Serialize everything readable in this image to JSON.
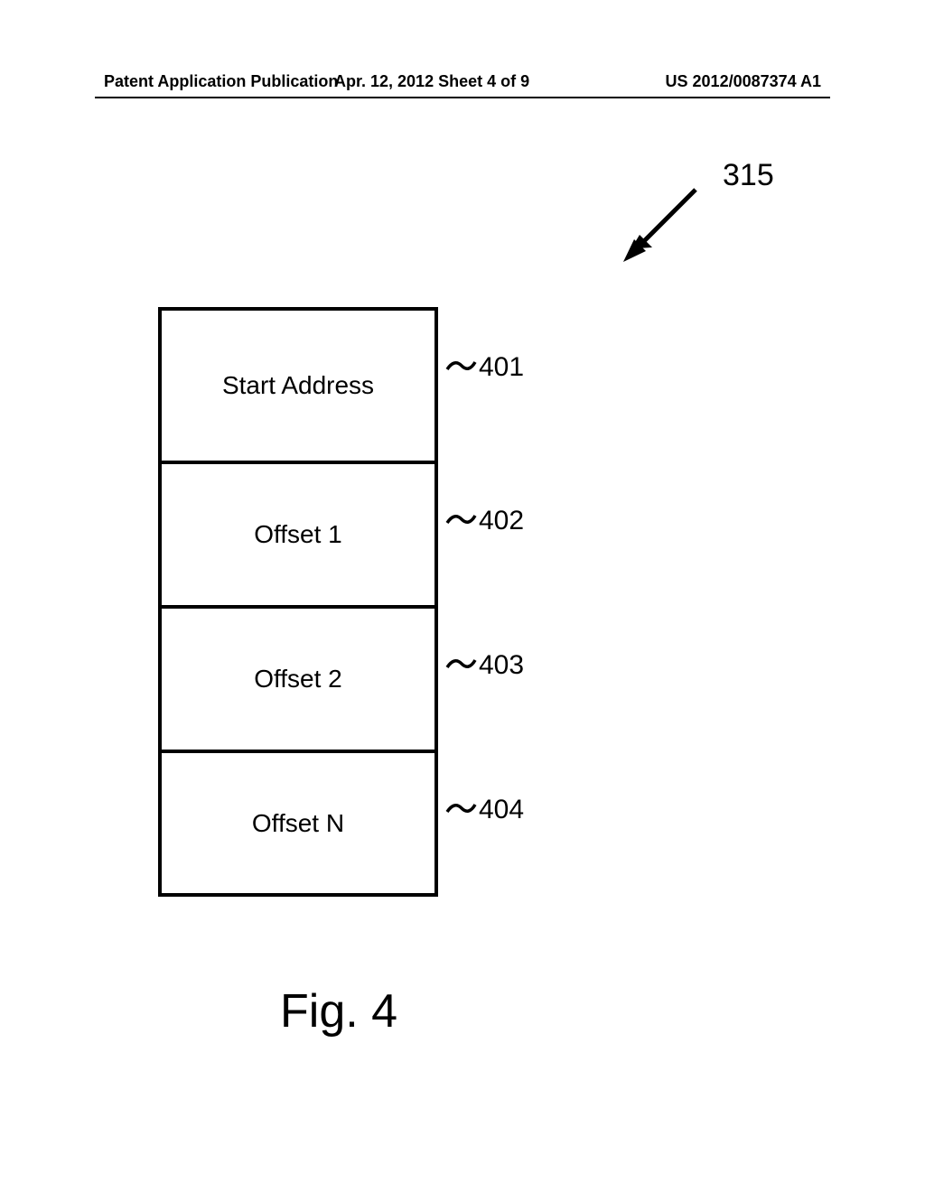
{
  "header": {
    "left": "Patent Application Publication",
    "center": "Apr. 12, 2012  Sheet 4 of 9",
    "right": "US 2012/0087374 A1"
  },
  "pointer_label": "315",
  "table": {
    "rows": [
      {
        "text": "Start Address",
        "ref": "401"
      },
      {
        "text": "Offset 1",
        "ref": "402"
      },
      {
        "text": "Offset 2",
        "ref": "403"
      },
      {
        "text": "Offset N",
        "ref": "404"
      }
    ]
  },
  "figure_label": "Fig. 4"
}
